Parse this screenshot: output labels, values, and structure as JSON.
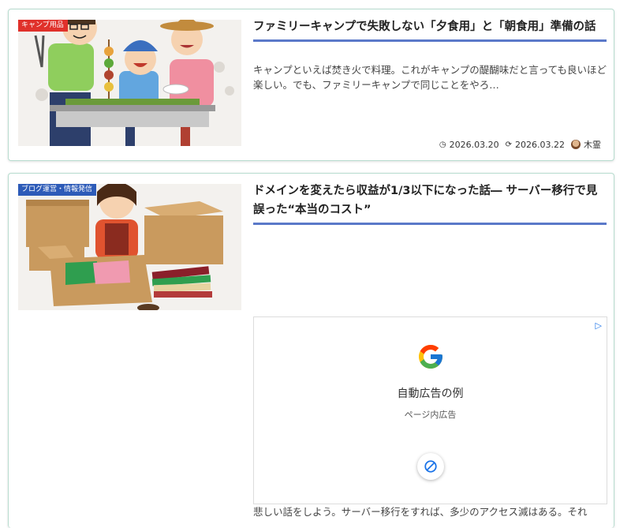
{
  "articles": [
    {
      "category": "キャンプ用品",
      "category_color": "#e0312b",
      "title": "ファミリーキャンプで失敗しない「夕食用」と「朝食用」準備の話",
      "snippet": "キャンプといえば焚き火で料理。これがキャンプの醍醐味だと言っても良いほど楽しい。でも、ファミリーキャンプで同じことをやろ…",
      "published": "2026.03.20",
      "updated": "2026.03.22",
      "author": "木霊",
      "thumbnail_icon": "family-bbq-illustration"
    },
    {
      "category": "ブログ運営・情報発信",
      "category_color": "#2d5bb8",
      "title": "ドメインを変えたら収益が1/3以下になった話― サーバー移行で見誤った“本当のコスト”",
      "snippet": "悲しい話をしよう。サーバー移行をすれば、多少のアクセス減はある。それ",
      "thumbnail_icon": "moving-boxes-illustration"
    }
  ],
  "ad": {
    "title": "自動広告の例",
    "subtitle": "ページ内広告",
    "adchoices_icon": "adchoices-triangle-icon",
    "logo_icon": "google-g-icon",
    "block_icon": "block-ad-icon"
  }
}
